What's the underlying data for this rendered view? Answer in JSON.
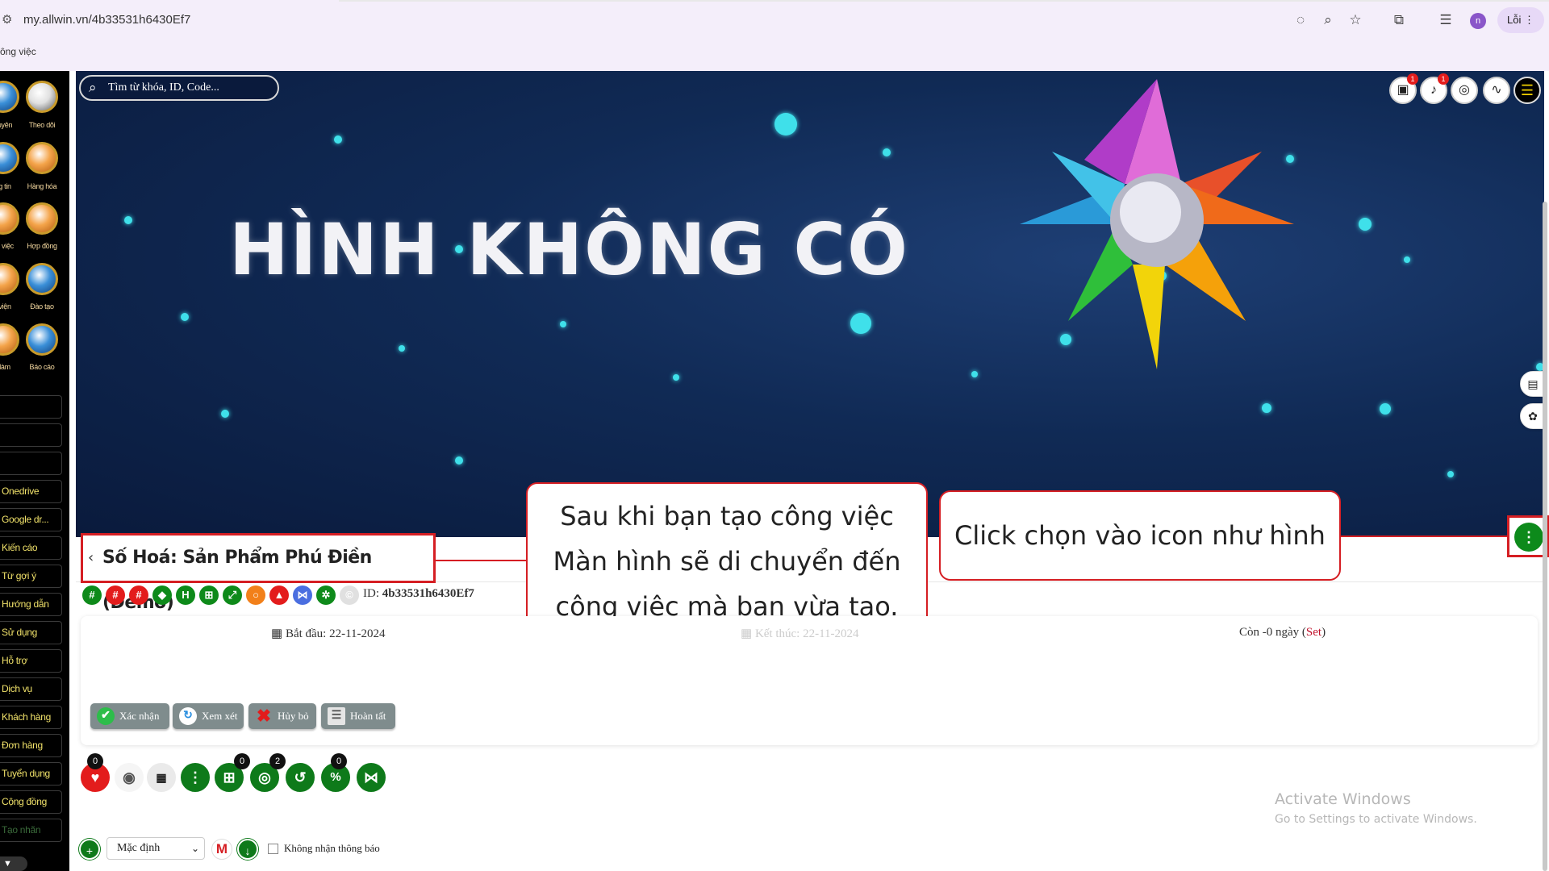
{
  "browser": {
    "url": "my.allwin.vn/4b33531h6430Ef7",
    "profile_initial": "n",
    "error_label": "Lỗi",
    "bookmark": "ông việc"
  },
  "sidebar": {
    "tiles": [
      {
        "label": "uyên",
        "icon": "resource-icon"
      },
      {
        "label": "Theo dõi",
        "icon": "follow-icon"
      },
      {
        "label": "g tin",
        "icon": "info-icon"
      },
      {
        "label": "Hàng hóa",
        "icon": "goods-icon"
      },
      {
        "label": "g việc",
        "icon": "work-icon"
      },
      {
        "label": "Hợp đồng",
        "icon": "contract-icon"
      },
      {
        "label": "viện",
        "icon": "library-icon"
      },
      {
        "label": "Đào tạo",
        "icon": "training-icon"
      },
      {
        "label": "làm",
        "icon": "job-icon"
      },
      {
        "label": "Báo cáo",
        "icon": "report-icon"
      }
    ],
    "menu": [
      "",
      "",
      "",
      "Onedrive",
      "Google dr...",
      "Kiến cáo",
      "Từ gợi ý",
      "Hướng dẫn",
      "Sử dụng",
      "Hỗ trợ",
      "Dịch vụ",
      "Khách hàng",
      "Đơn hàng",
      "Tuyển dụng",
      "Cộng đồng",
      "Tạo nhãn"
    ],
    "bottom_toggle": "▼"
  },
  "hero": {
    "search_placeholder": "Tìm từ khóa, ID, Code...",
    "banner_text": "HÌNH KHÔNG CÓ",
    "cart_badge": "1",
    "bell_badge": "1"
  },
  "task": {
    "title": "Số Hoá: Sản Phẩm Phú Điền (Demo)",
    "id_label": "ID:",
    "id_value": "4b33531h6430Ef7",
    "start_label": "Bắt đầu: 22-11-2024",
    "end_label": "Kết thúc: 22-11-2024",
    "remain_prefix": "Còn -0 ngày (",
    "remain_set": "Set",
    "remain_suffix": ")"
  },
  "actions": [
    {
      "label": "Xác nhận",
      "color": "#2dbd4a",
      "glyph": "✔"
    },
    {
      "label": "Xem xét",
      "color": "#2a8fe0",
      "glyph": "↻"
    },
    {
      "label": "Hủy bỏ",
      "color": "#e31c1c",
      "glyph": "✖"
    },
    {
      "label": "Hoàn tất",
      "color": "#cfcfcf",
      "glyph": "☰"
    }
  ],
  "circle_counts": {
    "like": "0",
    "add": "0",
    "views": "2",
    "percent": "0"
  },
  "callouts": {
    "left_line1": "Sau khi bạn tạo công việc",
    "left_line2": "Màn hình sẽ di chuyển đến",
    "left_line3": "công việc mà bạn vừa tạo.",
    "right": "Click chọn vào icon như hình"
  },
  "bottom": {
    "select_value": "Mặc định",
    "mail_glyph": "M",
    "checkbox_label": "Không nhận thông báo"
  },
  "watermark": {
    "line1": "Activate Windows",
    "line2": "Go to Settings to activate Windows."
  },
  "colors": {
    "accent_red": "#d51e23",
    "green": "#0e7a1a",
    "sidebar_text": "#f1e26a"
  }
}
